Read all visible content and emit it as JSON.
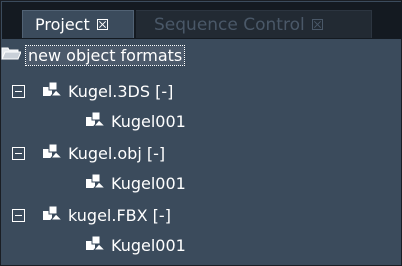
{
  "tabs": [
    {
      "label": "Project",
      "active": true
    },
    {
      "label": "Sequence Control",
      "active": false
    }
  ],
  "tree": {
    "root": {
      "label": "new object formats",
      "icon": "open-folder-icon"
    },
    "groups": [
      {
        "label": "Kugel.3DS [-]",
        "icon": "object-shapes-icon",
        "expanded": true,
        "child": {
          "label": "Kugel001",
          "icon": "object-shapes-icon"
        }
      },
      {
        "label": "Kugel.obj [-]",
        "icon": "object-shapes-icon",
        "expanded": true,
        "child": {
          "label": "Kugel001",
          "icon": "object-shapes-icon"
        }
      },
      {
        "label": "kugel.FBX [-]",
        "icon": "object-shapes-icon",
        "expanded": true,
        "child": {
          "label": "Kugel001",
          "icon": "object-shapes-icon"
        }
      }
    ]
  },
  "colors": {
    "panel_bg": "#3b4b5c",
    "tabbar_bg": "#141a21",
    "text": "#ffffff",
    "inactive_tab_text": "#4a5868"
  }
}
